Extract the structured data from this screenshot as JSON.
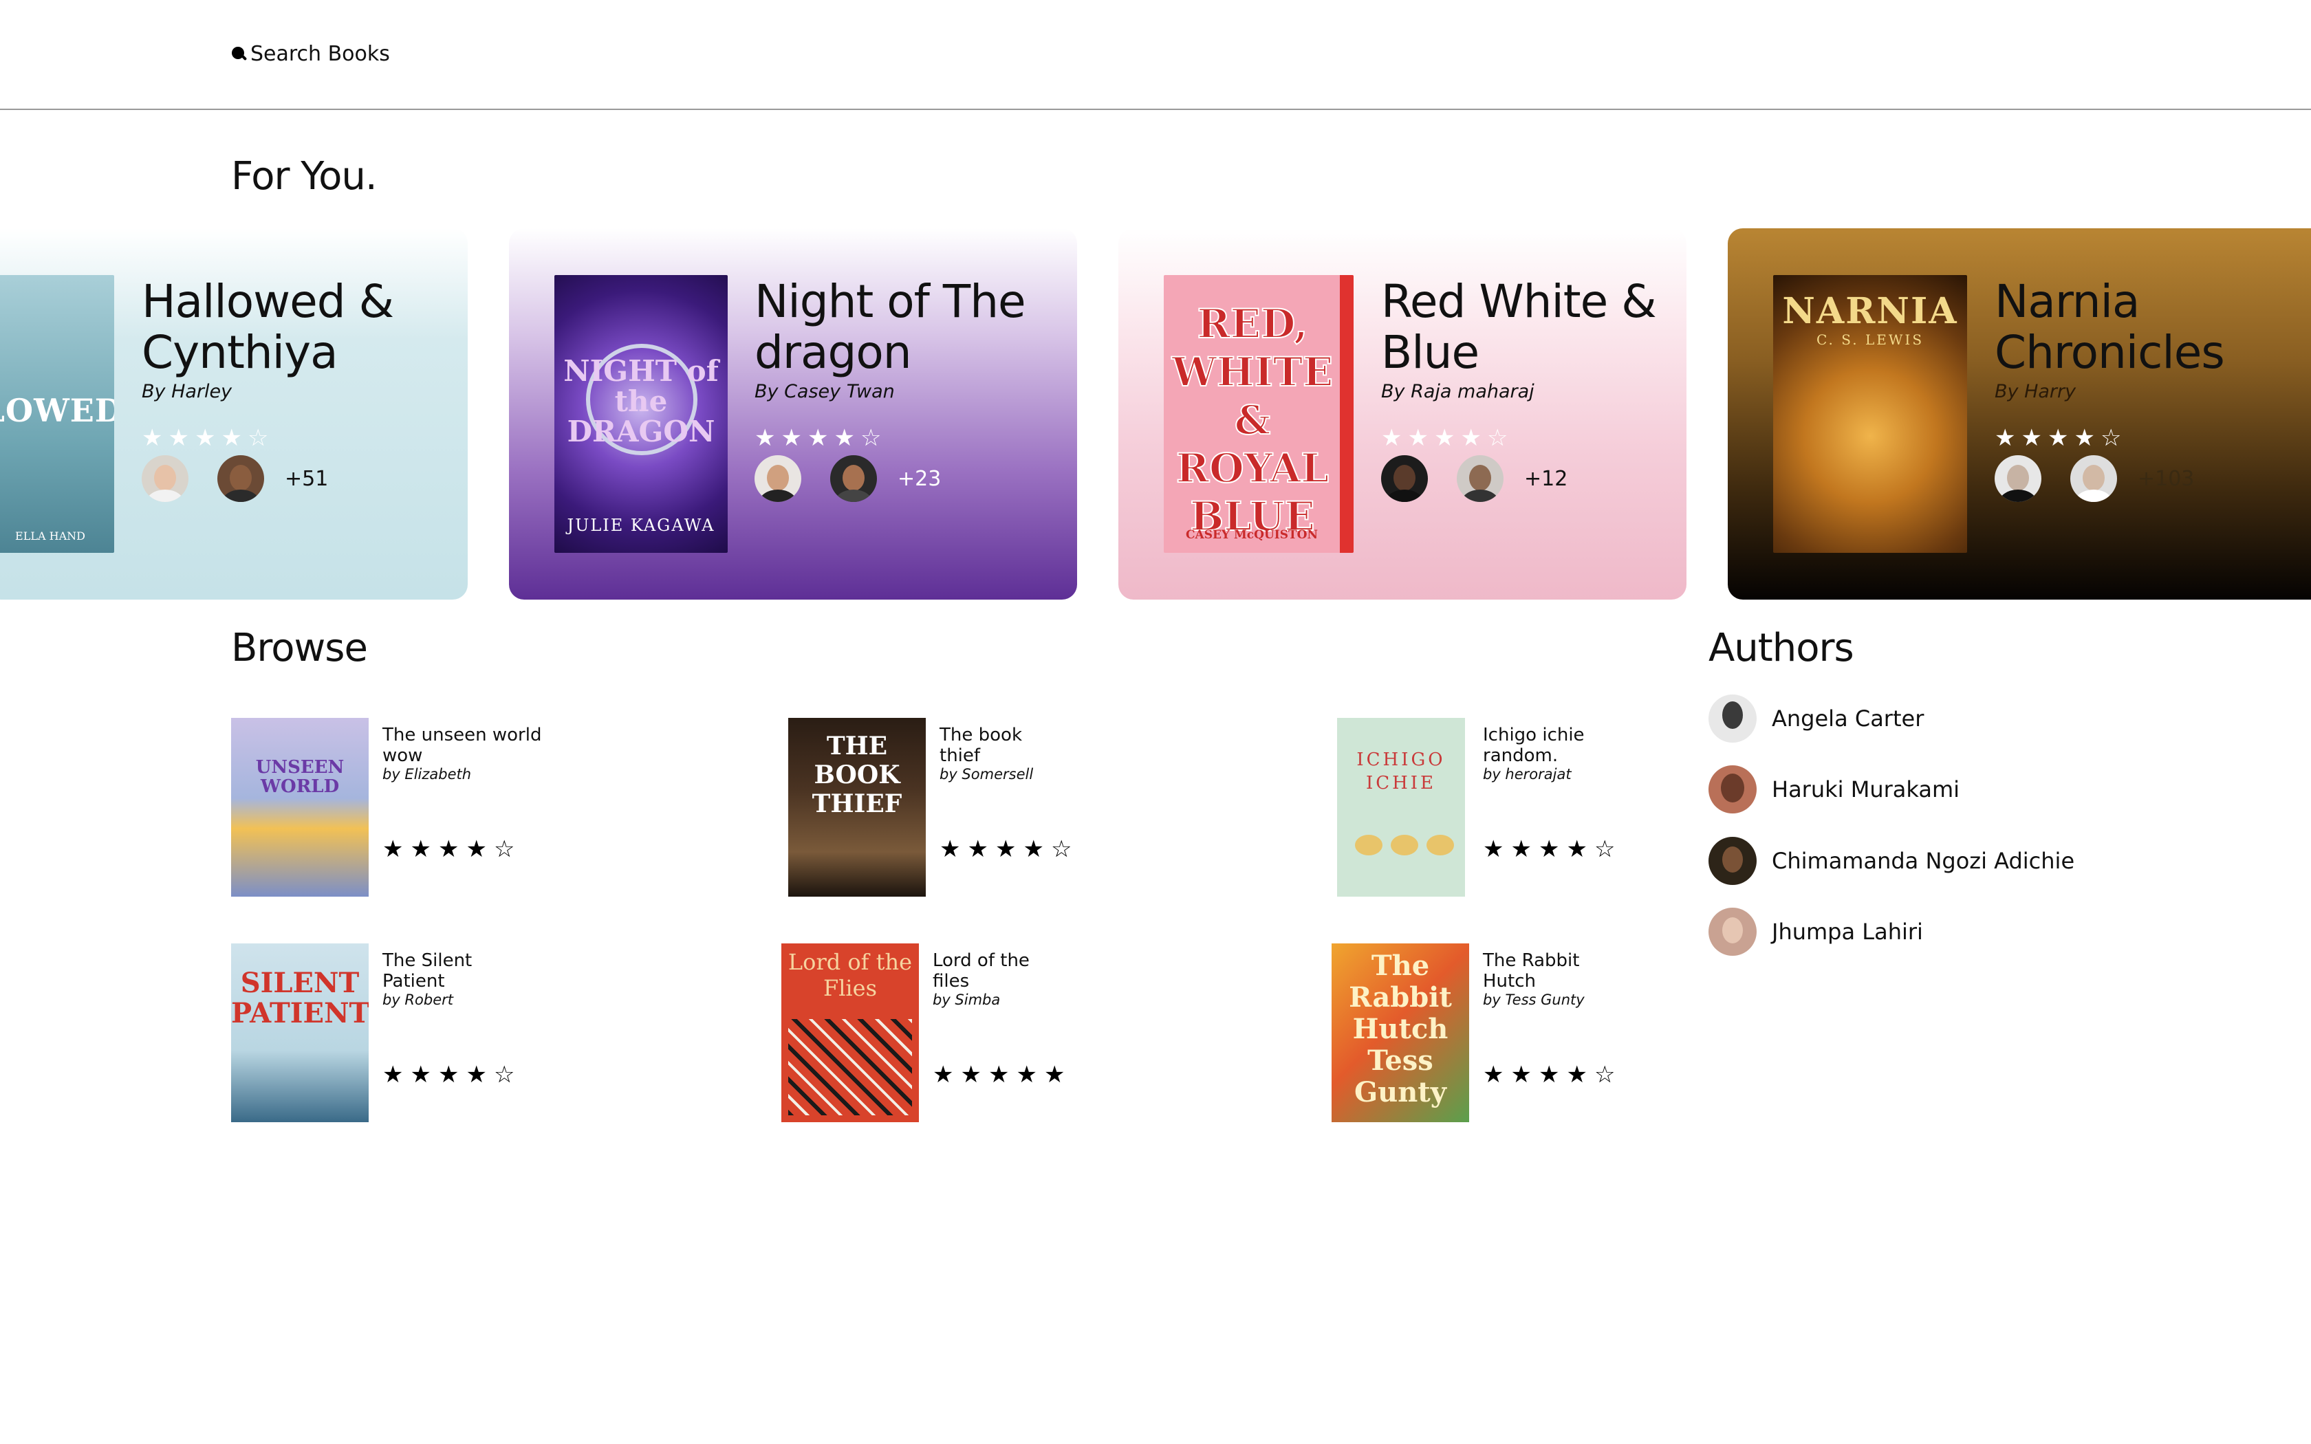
{
  "search": {
    "label": "Search Books"
  },
  "for_you": {
    "heading": "For You.",
    "cards": [
      {
        "title": "Hallowed & Cynthiya",
        "author": "By Harley",
        "rating": 4,
        "extra": "+51",
        "cover_text": "LLOWED",
        "cover_small": "ELLA HAND"
      },
      {
        "title": "Night of The dragon",
        "author": "By Casey Twan",
        "rating": 4,
        "extra": "+23",
        "cover_text": "NIGHT of the DRAGON",
        "cover_small": "JULIE KAGAWA"
      },
      {
        "title": "Red White & Blue",
        "author": "By Raja maharaj",
        "rating": 4,
        "extra": "+12",
        "cover_text": "RED, WHITE & ROYAL BLUE",
        "cover_small": "CASEY McQUISTON"
      },
      {
        "title": "Narnia Chronicles",
        "author": "By Harry",
        "rating": 4,
        "extra": "+103",
        "cover_text": "NARNIA",
        "cover_small": "C. S. LEWIS"
      }
    ]
  },
  "browse": {
    "heading": "Browse",
    "items": [
      {
        "title": "The unseen world wow",
        "author": "by Elizabeth",
        "rating": 4,
        "cover_text": "UNSEEN WORLD"
      },
      {
        "title": "The book thief",
        "author": "by Somersell",
        "rating": 4,
        "cover_text": "THE BOOK THIEF"
      },
      {
        "title": "Ichigo ichie random.",
        "author": "by herorajat",
        "rating": 4,
        "cover_text": "ICHIGO ICHIE"
      },
      {
        "title": "The Silent Patient",
        "author": "by Robert",
        "rating": 4,
        "cover_text": "SILENT PATIENT"
      },
      {
        "title": "Lord of the files",
        "author": "by Simba",
        "rating": 5,
        "cover_text": "Lord of the Flies"
      },
      {
        "title": "The Rabbit Hutch",
        "author": "by Tess Gunty",
        "rating": 4,
        "cover_text": "The Rabbit Hutch Tess Gunty"
      }
    ]
  },
  "authors": {
    "heading": "Authors",
    "list": [
      {
        "name": "Angela Carter"
      },
      {
        "name": "Haruki Murakami"
      },
      {
        "name": "Chimamanda Ngozi Adichie"
      },
      {
        "name": "Jhumpa Lahiri"
      }
    ]
  },
  "icons": {
    "search": "search-icon",
    "star_full": "★",
    "star_empty": "☆"
  }
}
